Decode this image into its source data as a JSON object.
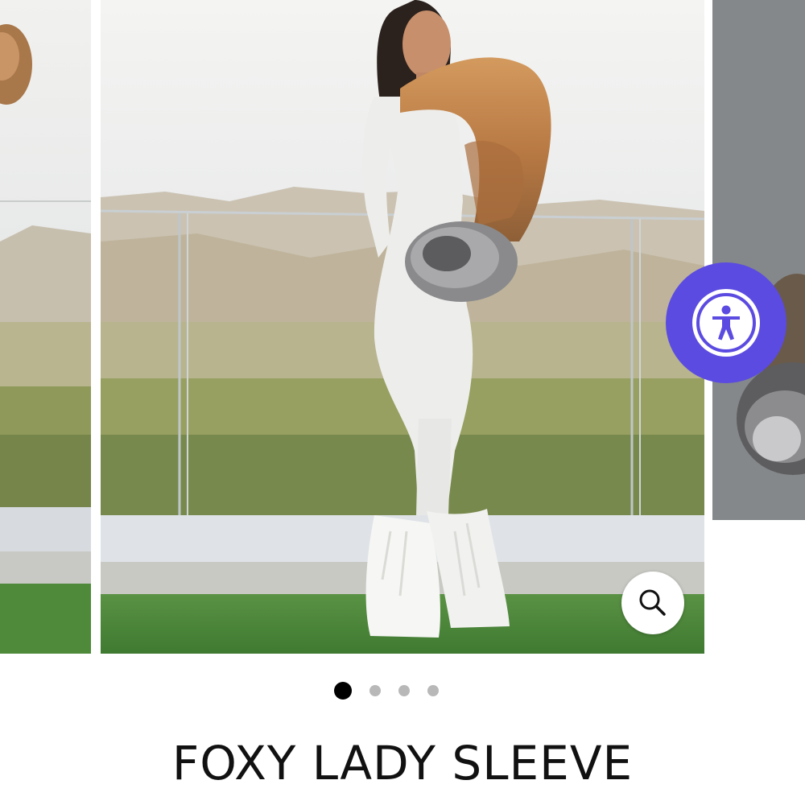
{
  "carousel": {
    "slides": [
      {
        "role": "previous",
        "image": "fur-sleeve-photo"
      },
      {
        "role": "current",
        "image": "model-in-white-catsuit-with-fox-fur-sleeve"
      },
      {
        "role": "next",
        "image": "fur-sleeve-closeup"
      }
    ],
    "current_index": 1,
    "total": 4
  },
  "buttons": {
    "zoom_icon": "magnifier-icon",
    "accessibility_icon": "accessibility-person-icon",
    "accent_color": "#5b4be1"
  },
  "product": {
    "title": "FOXY LADY SLEEVE"
  }
}
